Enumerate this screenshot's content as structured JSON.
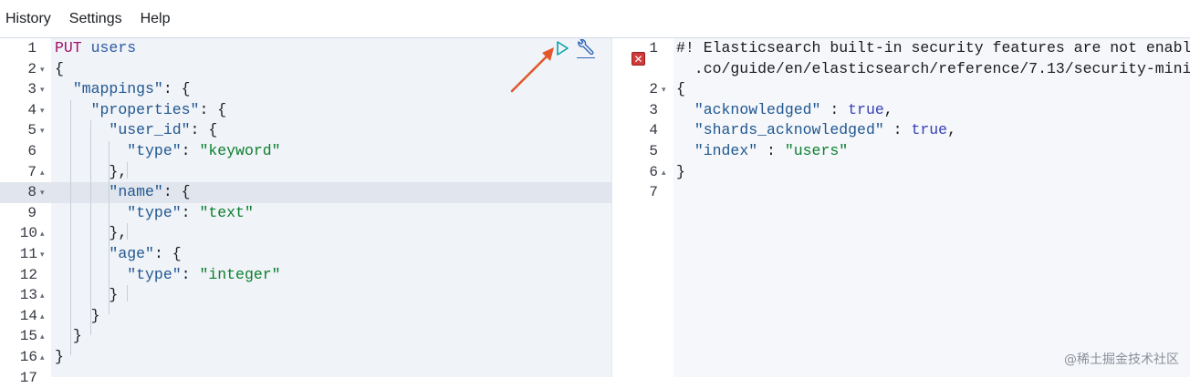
{
  "menu": {
    "items": [
      "History",
      "Settings",
      "Help"
    ]
  },
  "request": {
    "line_numbers": [
      "1",
      "2",
      "3",
      "4",
      "5",
      "6",
      "7",
      "8",
      "9",
      "10",
      "11",
      "12",
      "13",
      "14",
      "15",
      "16",
      "17"
    ],
    "lines": [
      {
        "method": "PUT",
        "url": " users"
      },
      {
        "text": "{"
      },
      {
        "indent": "  ",
        "key": "\"mappings\"",
        "rest": ": {"
      },
      {
        "indent": "    ",
        "key": "\"properties\"",
        "rest": ": {"
      },
      {
        "indent": "      ",
        "key": "\"user_id\"",
        "rest": ": {"
      },
      {
        "indent": "        ",
        "key": "\"type\"",
        "sep": ": ",
        "value": "\"keyword\""
      },
      {
        "indent": "      ",
        "text": "},"
      },
      {
        "indent": "      ",
        "key": "\"name\"",
        "rest": ": {"
      },
      {
        "indent": "        ",
        "key": "\"type\"",
        "sep": ": ",
        "value": "\"text\""
      },
      {
        "indent": "      ",
        "text": "},"
      },
      {
        "indent": "      ",
        "key": "\"age\"",
        "rest": ": {"
      },
      {
        "indent": "        ",
        "key": "\"type\"",
        "sep": ": ",
        "value": "\"integer\""
      },
      {
        "indent": "      ",
        "text": "}"
      },
      {
        "indent": "    ",
        "text": "}"
      },
      {
        "indent": "  ",
        "text": "}"
      },
      {
        "text": "}"
      },
      {
        "text": ""
      }
    ]
  },
  "response": {
    "line_numbers": [
      "1",
      "",
      "2",
      "3",
      "4",
      "5",
      "6",
      "7"
    ],
    "warning_line1": "#! Elasticsearch built-in security features are not enabl",
    "warning_line2": "  .co/guide/en/elasticsearch/reference/7.13/security-mini",
    "open_brace": "{",
    "rows": [
      {
        "key": "\"acknowledged\"",
        "sep": " : ",
        "value": "true",
        "end": ","
      },
      {
        "key": "\"shards_acknowledged\"",
        "sep": " : ",
        "value": "true",
        "end": ","
      },
      {
        "key": "\"index\"",
        "sep": " : ",
        "value": "\"users\"",
        "end": ""
      }
    ],
    "close_brace": "}"
  },
  "toolbar": {
    "run_icon": "play-icon",
    "settings_icon": "wrench-icon"
  },
  "colors": {
    "method": "#a3116b",
    "string_value": "#0c7f2f",
    "key": "#215891",
    "boolean": "#3740b5",
    "error": "#cf3a3a",
    "arrow": "#e2572b"
  },
  "watermark": "@稀土掘金技术社区"
}
